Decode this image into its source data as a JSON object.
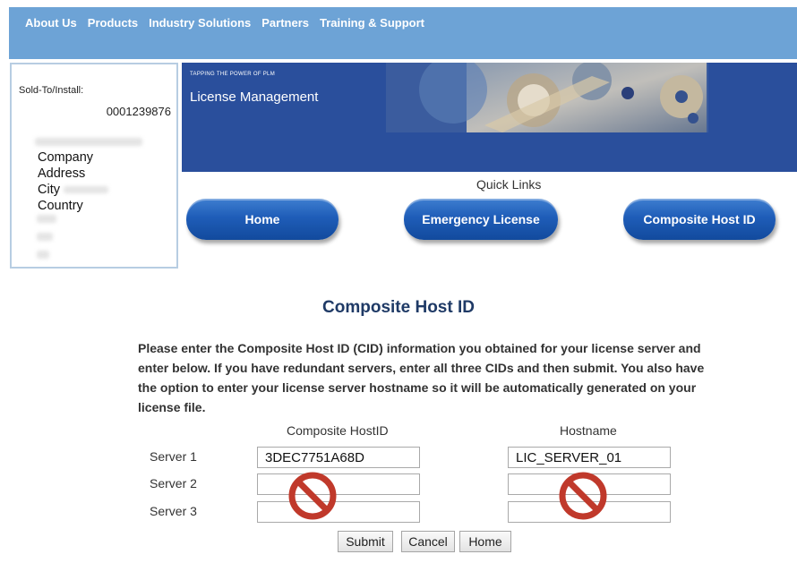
{
  "nav": {
    "items": [
      "About Us",
      "Products",
      "Industry Solutions",
      "Partners",
      "Training & Support"
    ]
  },
  "soldto": {
    "label": "Sold-To/Install:",
    "number": "0001239876",
    "company": "Company",
    "address": "Address",
    "city": "City",
    "country": "Country"
  },
  "banner": {
    "tagline": "TAPPING THE POWER OF PLM",
    "title": "License Management"
  },
  "quick_links": {
    "label": "Quick Links",
    "home": "Home",
    "emergency": "Emergency License",
    "composite": "Composite Host ID"
  },
  "form": {
    "heading": "Composite Host ID",
    "description": "Please enter the Composite Host ID (CID) information you obtained for your license server and enter below. If you have redundant servers, enter all three CIDs and then submit. You also have the option to enter your license server hostname so it will be automatically generated on your license file.",
    "col_cid": "Composite HostID",
    "col_host": "Hostname",
    "servers": [
      {
        "label": "Server 1",
        "cid": "3DEC7751A68D",
        "host": "LIC_SERVER_01"
      },
      {
        "label": "Server 2",
        "cid": "",
        "host": ""
      },
      {
        "label": "Server 3",
        "cid": "",
        "host": ""
      }
    ],
    "submit": "Submit",
    "cancel": "Cancel",
    "home": "Home"
  },
  "icons": {
    "forbid_cid": "prohibited-icon",
    "forbid_host": "prohibited-icon"
  },
  "colors": {
    "nav_bg": "#6da3d6",
    "banner_bg": "#2a4f9c",
    "button_blue": "#1f5db8",
    "heading": "#1f3a66",
    "prohibited": "#c0392b"
  }
}
